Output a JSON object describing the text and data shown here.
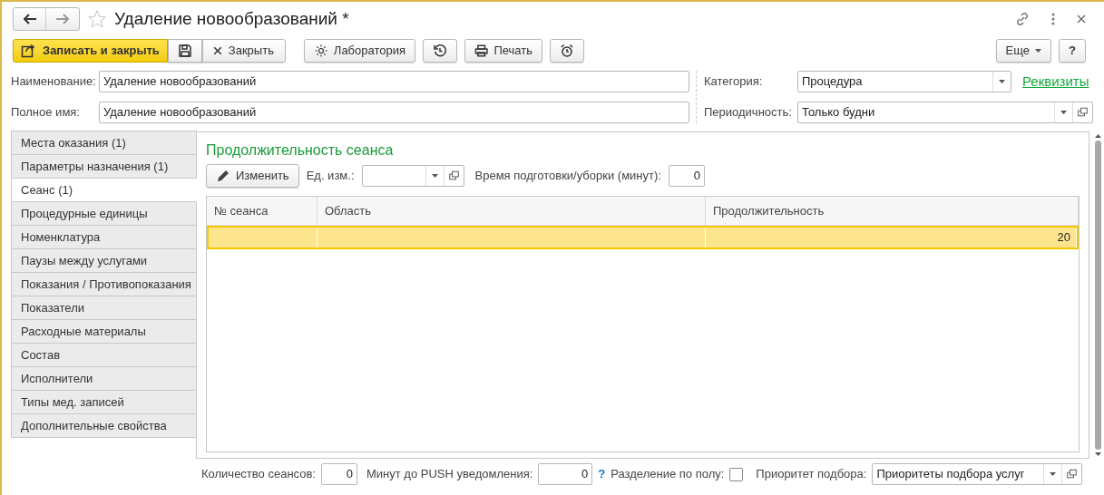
{
  "window": {
    "title": "Удаление новообразований *"
  },
  "toolbar": {
    "buttons": [
      {
        "kind": "primary",
        "label": "Записать и закрыть"
      },
      {
        "kind": "save"
      },
      {
        "kind": "close",
        "label": "Закрыть"
      },
      {
        "kind": "gap"
      },
      {
        "kind": "lab",
        "label": "Лаборатория"
      },
      {
        "kind": "history"
      },
      {
        "kind": "print",
        "label": "Печать"
      },
      {
        "kind": "alarm"
      }
    ],
    "more": "Еще",
    "help": "?"
  },
  "fields": {
    "name": {
      "label": "Наименование:",
      "value": "Удаление новообразований"
    },
    "full_name": {
      "label": "Полное имя:",
      "value": "Удаление новообразований"
    },
    "category": {
      "label": "Категория:",
      "value": "Процедура"
    },
    "periodicity": {
      "label": "Периодичность:",
      "value": "Только будни"
    },
    "link": "Реквизиты"
  },
  "tabs": [
    {
      "label": "Места оказания (1)",
      "selected": false
    },
    {
      "label": "Параметры назначения (1)",
      "selected": false
    },
    {
      "label": "Сеанс (1)",
      "selected": true
    },
    {
      "label": "Процедурные единицы",
      "selected": false
    },
    {
      "label": "Номенклатура",
      "selected": false
    },
    {
      "label": "Паузы между услугами",
      "selected": false
    },
    {
      "label": "Показания / Противопоказания",
      "selected": false
    },
    {
      "label": "Показатели",
      "selected": false
    },
    {
      "label": "Расходные материалы",
      "selected": false
    },
    {
      "label": "Состав",
      "selected": false
    },
    {
      "label": "Исполнители",
      "selected": false
    },
    {
      "label": "Типы мед. записей",
      "selected": false
    },
    {
      "label": "Дополнительные свойства",
      "selected": false
    }
  ],
  "session": {
    "heading": "Продолжительность сеанса",
    "edit_button": "Изменить",
    "unit_label": "Ед. изм.:",
    "prep_label": "Время подготовки/уборки (минут):",
    "prep_value": "0",
    "table": {
      "columns": [
        "№ сеанса",
        "Область",
        "Продолжительность"
      ],
      "rows": [
        {
          "cells": [
            "",
            "",
            "20"
          ],
          "selected": true
        }
      ]
    },
    "count_label": "Количество сеансов:",
    "count_value": "0",
    "push_label": "Минут до PUSH уведомления:",
    "push_value": "0",
    "help": "?",
    "gender_label": "Разделение по полу:",
    "gender_checked": false,
    "priority_label": "Приоритет подбора:",
    "priority_value": "Приоритеты подбора услуг"
  }
}
